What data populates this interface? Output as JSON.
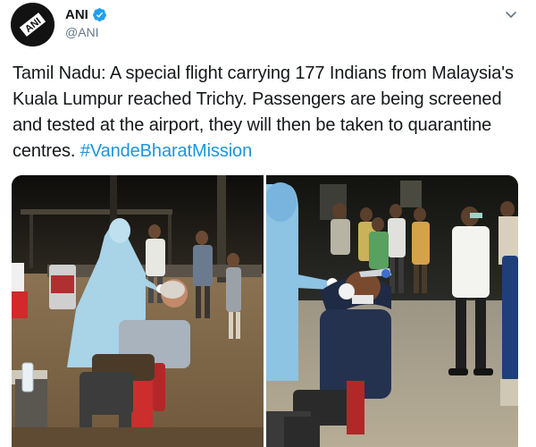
{
  "author": {
    "display_name": "ANI",
    "handle": "@ANI",
    "avatar_logo": "ANI",
    "verified": true
  },
  "tweet": {
    "text": "Tamil Nadu: A special flight carrying 177 Indians from Malaysia's Kuala Lumpur reached Trichy. Passengers are being screened and tested at the airport, they will then be taken to quarantine centres. ",
    "hashtag": "#VandeBharatMission"
  },
  "media": {
    "photos": [
      {
        "icon": "photo-swab-test-seated-passenger"
      },
      {
        "icon": "photo-nasal-swab-test-passenger"
      }
    ]
  },
  "colors": {
    "verified_badge": "#1da1f2",
    "hashtag": "#1b95e0",
    "text": "#14171a",
    "secondary": "#657786"
  }
}
